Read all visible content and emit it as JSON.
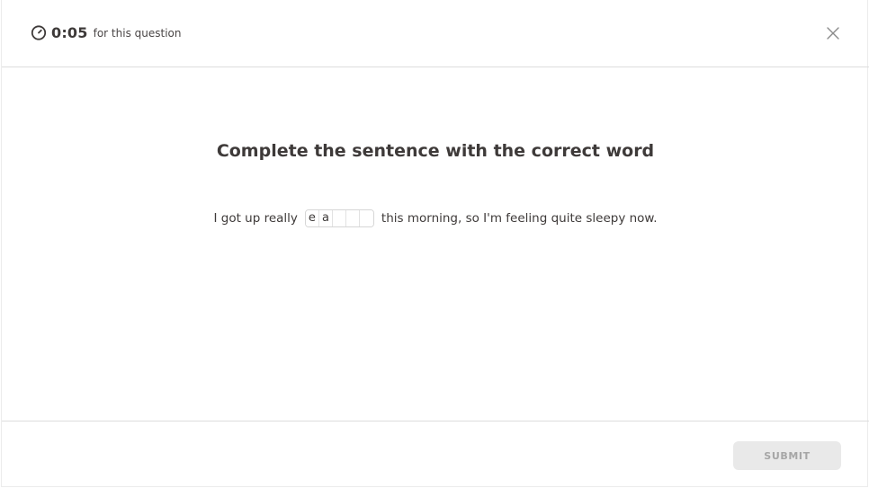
{
  "header": {
    "timer_value": "0:05",
    "timer_caption": "for this question",
    "timer_icon": "stopwatch-icon",
    "close_icon": "close-icon"
  },
  "question": {
    "prompt": "Complete the sentence with the correct word",
    "before_text": "I got up really",
    "after_text": "this morning, so I'm feeling quite sleepy now.",
    "letters": [
      "e",
      "a",
      "",
      "",
      ""
    ]
  },
  "footer": {
    "submit_label": "SUBMIT"
  },
  "colors": {
    "text": "#3e3a39",
    "divider": "#dcdcdc",
    "submit_bg": "#e9e9e9",
    "submit_text": "#a6a6a6"
  }
}
